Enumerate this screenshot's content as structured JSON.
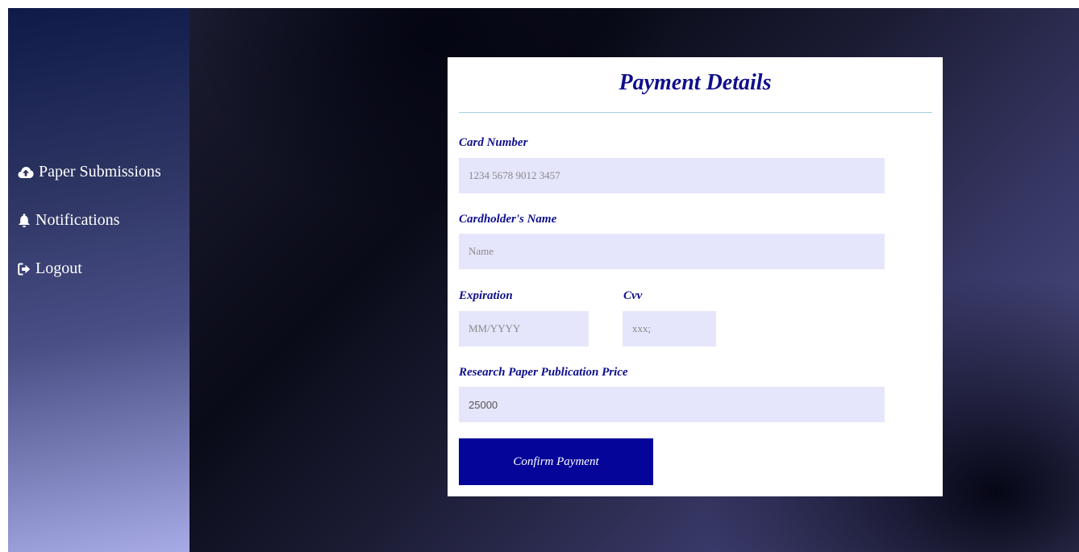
{
  "sidebar": {
    "items": [
      {
        "label": "Paper Submissions",
        "icon": "cloud-upload-icon"
      },
      {
        "label": "Notifications",
        "icon": "bell-icon"
      },
      {
        "label": "Logout",
        "icon": "sign-out-icon"
      }
    ]
  },
  "payment": {
    "title": "Payment Details",
    "card_number": {
      "label": "Card Number",
      "placeholder": "1234 5678 9012 3457",
      "value": ""
    },
    "cardholder": {
      "label": "Cardholder's Name",
      "placeholder": "Name",
      "value": ""
    },
    "expiration": {
      "label": "Expiration",
      "placeholder": "MM/YYYY",
      "value": ""
    },
    "cvv": {
      "label": "Cvv",
      "placeholder": "xxx;",
      "value": ""
    },
    "price": {
      "label": "Research Paper Publication Price",
      "value": "25000"
    },
    "confirm_label": "Confirm Payment"
  },
  "colors": {
    "accent": "#05059a",
    "label": "#0f0f8c",
    "input_bg": "#e5e5fb",
    "divider": "#9fd3e2"
  }
}
